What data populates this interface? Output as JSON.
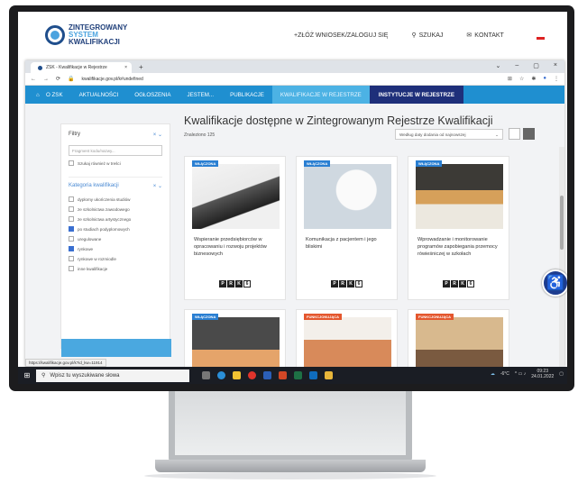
{
  "site": {
    "logo": {
      "line1": "ZINTEGROWANY",
      "line2": "SYSTEM",
      "line3": "KWALIFIKACJI"
    },
    "links": [
      {
        "icon": "plus-icon",
        "label": "+ZŁÓŻ WNIOSEK/ZALOGUJ SIĘ"
      },
      {
        "icon": "search-icon",
        "label": "SZUKAJ"
      },
      {
        "icon": "mail-icon",
        "label": "KONTAKT"
      }
    ]
  },
  "browser": {
    "tab_title": "ZSK - Kwalifikacje w Rejestrze",
    "new_tab": "+",
    "url": "kwalifikacje.gov.pl/k#undefined",
    "status_url": "https://kwalifikacje.gov.pl/k?id_kw=11914"
  },
  "nav": {
    "items": [
      "O ZSK",
      "AKTUALNOŚCI",
      "OGŁOSZENIA",
      "JESTEM...",
      "PUBLIKACJE",
      "KWALIFIKACJE W REJESTRZE",
      "INSTYTUCJE W REJESTRZE"
    ],
    "active": "KWALIFIKACJE W REJESTRZE"
  },
  "sidebar": {
    "filters_label": "Filtry",
    "search_placeholder": "Fragment kodu/nazwy...",
    "search_also": "Szukaj również w treści",
    "category_label": "Kategoria kwalifikacji",
    "categories": [
      {
        "label": "dyplomy ukończenia studiów",
        "checked": false
      },
      {
        "label": "ze szkolnictwa zawodowego",
        "checked": false
      },
      {
        "label": "ze szkolnictwa artystycznego",
        "checked": false
      },
      {
        "label": "po studiach podyplomowych",
        "checked": true
      },
      {
        "label": "uregulowane",
        "checked": false
      },
      {
        "label": "rynkowe",
        "checked": true
      },
      {
        "label": "rynkowe w rozmiodle",
        "checked": false
      },
      {
        "label": "inne kwalifikacje",
        "checked": false
      }
    ]
  },
  "main": {
    "title": "Kwalifikacje dostępne w Zintegrowanym Rejestrze Kwalifikacji",
    "found": "Znaleziono 125",
    "sort": "Według daty dodania od najnowszej"
  },
  "cards": [
    {
      "badge": "WŁĄCZONA",
      "title": "Wspieranie przedsiębiorców w opracowaniu i rozwoju projektów biznesowych",
      "prk": [
        "P",
        "R",
        "K",
        "6"
      ]
    },
    {
      "badge": "WŁĄCZONA",
      "title": "Komunikacja z pacjentem i jego bliskimi",
      "prk": [
        "P",
        "R",
        "K",
        "6"
      ]
    },
    {
      "badge": "WŁĄCZONA",
      "title": "Wprowadzanie i monitorowanie programów zapobiegania przemocy rówieśniczej w szkołach",
      "prk": [
        "P",
        "R",
        "K",
        "6"
      ]
    }
  ],
  "cards_row2": [
    {
      "badge": "WŁĄCZONA"
    },
    {
      "badge": "FUNKCJONUJĄCA"
    },
    {
      "badge": "FUNKCJONUJĄCA"
    }
  ],
  "taskbar": {
    "search_placeholder": "Wpisz tu wyszukiwane słowa",
    "weather": "-6°C",
    "time": "09:23",
    "date": "24.01.2022"
  }
}
